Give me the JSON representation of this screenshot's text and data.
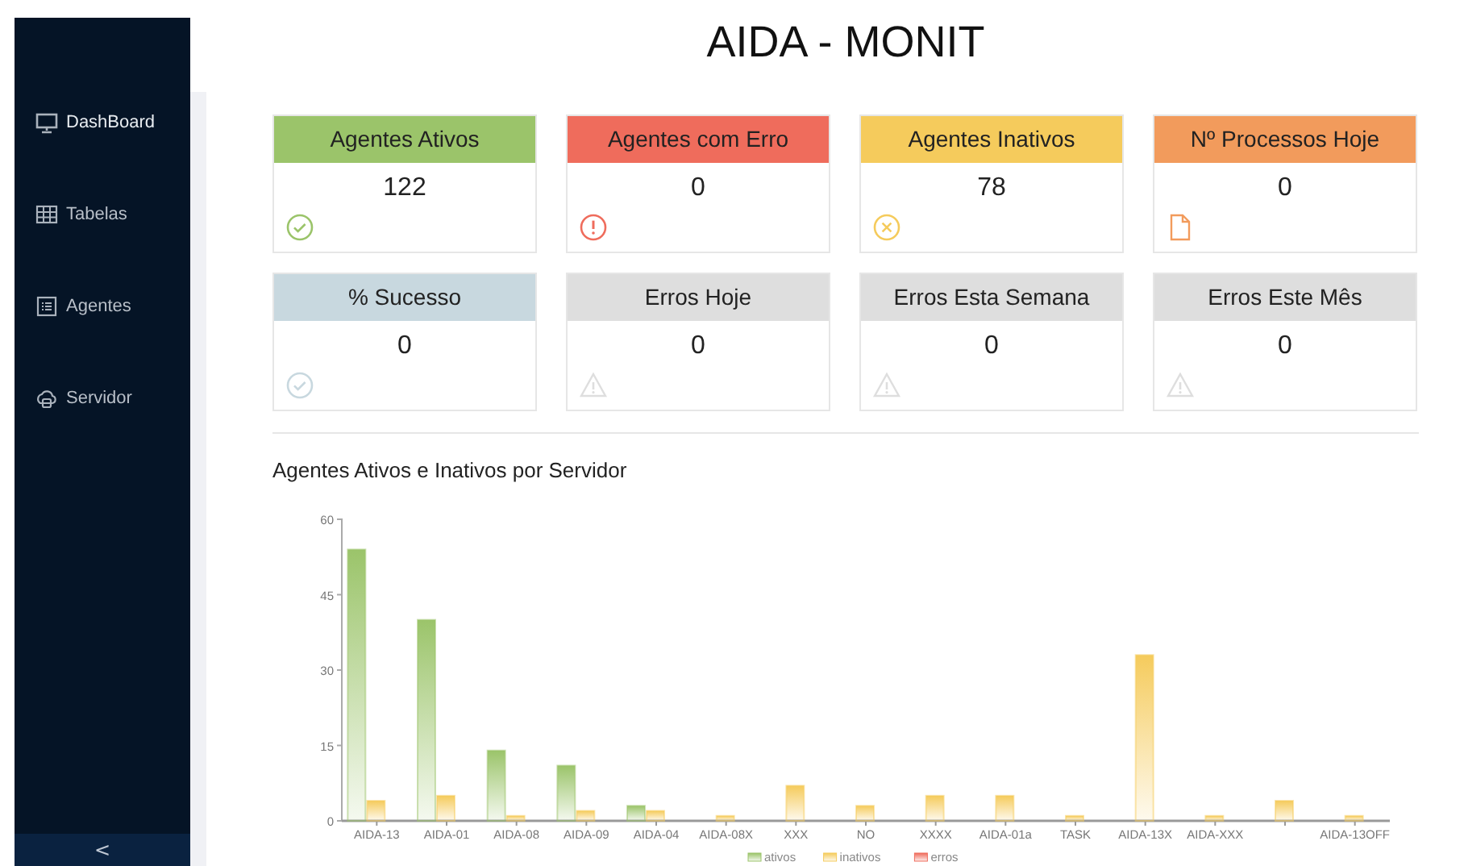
{
  "sidebar": {
    "items": [
      {
        "label": "DashBoard",
        "kind": "monitor",
        "selected": true
      },
      {
        "label": "Tabelas",
        "kind": "table",
        "selected": false
      },
      {
        "label": "Agentes",
        "kind": "list",
        "selected": false
      },
      {
        "label": "Servidor",
        "kind": "cloud",
        "selected": false
      }
    ],
    "collapse": "<"
  },
  "title": "AIDA - MONIT",
  "cards": [
    {
      "title": "Agentes Ativos",
      "value": "122",
      "color": "#9bc46a",
      "kind": "check"
    },
    {
      "title": "Agentes com Erro",
      "value": "0",
      "color": "#ef6c5c",
      "kind": "error"
    },
    {
      "title": "Agentes Inativos",
      "value": "78",
      "color": "#f5cb5c",
      "kind": "cancel"
    },
    {
      "title": "Nº Processos Hoje",
      "value": "0",
      "color": "#f29b5c",
      "kind": "file"
    },
    {
      "title": "% Sucesso",
      "value": "0",
      "color": "#c8d8df",
      "kind": "check"
    },
    {
      "title": "Erros Hoje",
      "value": "0",
      "color": "#dedede",
      "kind": "warning"
    },
    {
      "title": "Erros Esta Semana",
      "value": "0",
      "color": "#dedede",
      "kind": "warning"
    },
    {
      "title": "Erros Este Mês",
      "value": "0",
      "color": "#dedede",
      "kind": "warning"
    }
  ],
  "chart": {
    "title": "Agentes Ativos e Inativos por Servidor",
    "chart_data": {
      "type": "bar",
      "categories": [
        "AIDA-13",
        "AIDA-01",
        "AIDA-08",
        "AIDA-09",
        "AIDA-04",
        "AIDA-08X",
        "XXX",
        "NO",
        "XXXX",
        "AIDA-01a",
        "TASK",
        "AIDA-13X",
        "AIDA-XXX",
        null,
        "AIDA-13OFF"
      ],
      "series": [
        {
          "name": "ativos",
          "color": "#9bc46a",
          "values": [
            54,
            40,
            14,
            11,
            3,
            0,
            0,
            0,
            0,
            0,
            0,
            0,
            0,
            0,
            0
          ]
        },
        {
          "name": "inativos",
          "color": "#f5cb5c",
          "values": [
            4,
            5,
            1,
            2,
            2,
            1,
            7,
            3,
            5,
            5,
            1,
            33,
            1,
            4,
            1
          ]
        },
        {
          "name": "erros",
          "color": "#ef6c5c",
          "values": [
            0,
            0,
            0,
            0,
            0,
            0,
            0,
            0,
            0,
            0,
            0,
            0,
            0,
            0,
            0
          ]
        }
      ],
      "legend": "bottom",
      "ylim": [
        0,
        60
      ],
      "yticks": [
        0,
        15,
        30,
        45,
        60
      ]
    }
  }
}
